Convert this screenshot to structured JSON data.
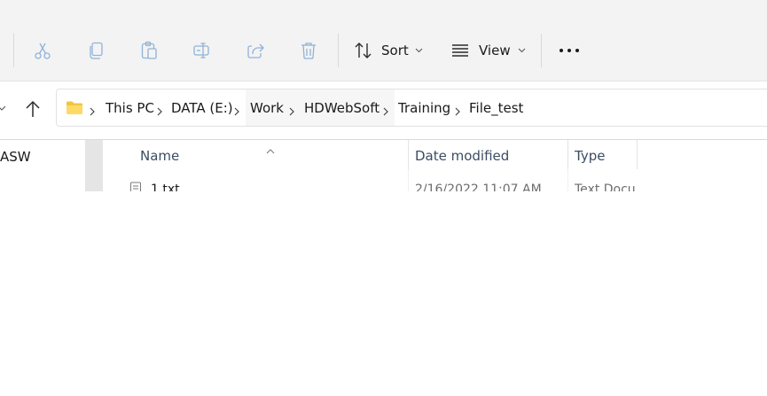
{
  "toolbar": {
    "sort_label": "Sort",
    "view_label": "View",
    "icons": [
      "cut-icon",
      "copy-icon",
      "paste-icon",
      "rename-icon",
      "share-icon",
      "delete-icon",
      "sort-icon",
      "view-icon",
      "more-icon"
    ]
  },
  "address": {
    "crumbs": [
      "This PC",
      "DATA (E:)",
      "Work",
      "HDWebSoft",
      "Training",
      "File_test"
    ]
  },
  "sidebar": {
    "partial_item": "ASW"
  },
  "columns": {
    "name": "Name",
    "date_modified": "Date modified",
    "type": "Type"
  },
  "rows": [
    {
      "name": "1.txt",
      "date": "2/16/2022 11:07 AM",
      "type": "Text Docu"
    }
  ],
  "colors": {
    "toolbar_bg": "#f3f3f3",
    "disabled_icon": "#8fb3d9",
    "folder_yellow": "#f2c53d",
    "header_text": "#3b4d63"
  }
}
